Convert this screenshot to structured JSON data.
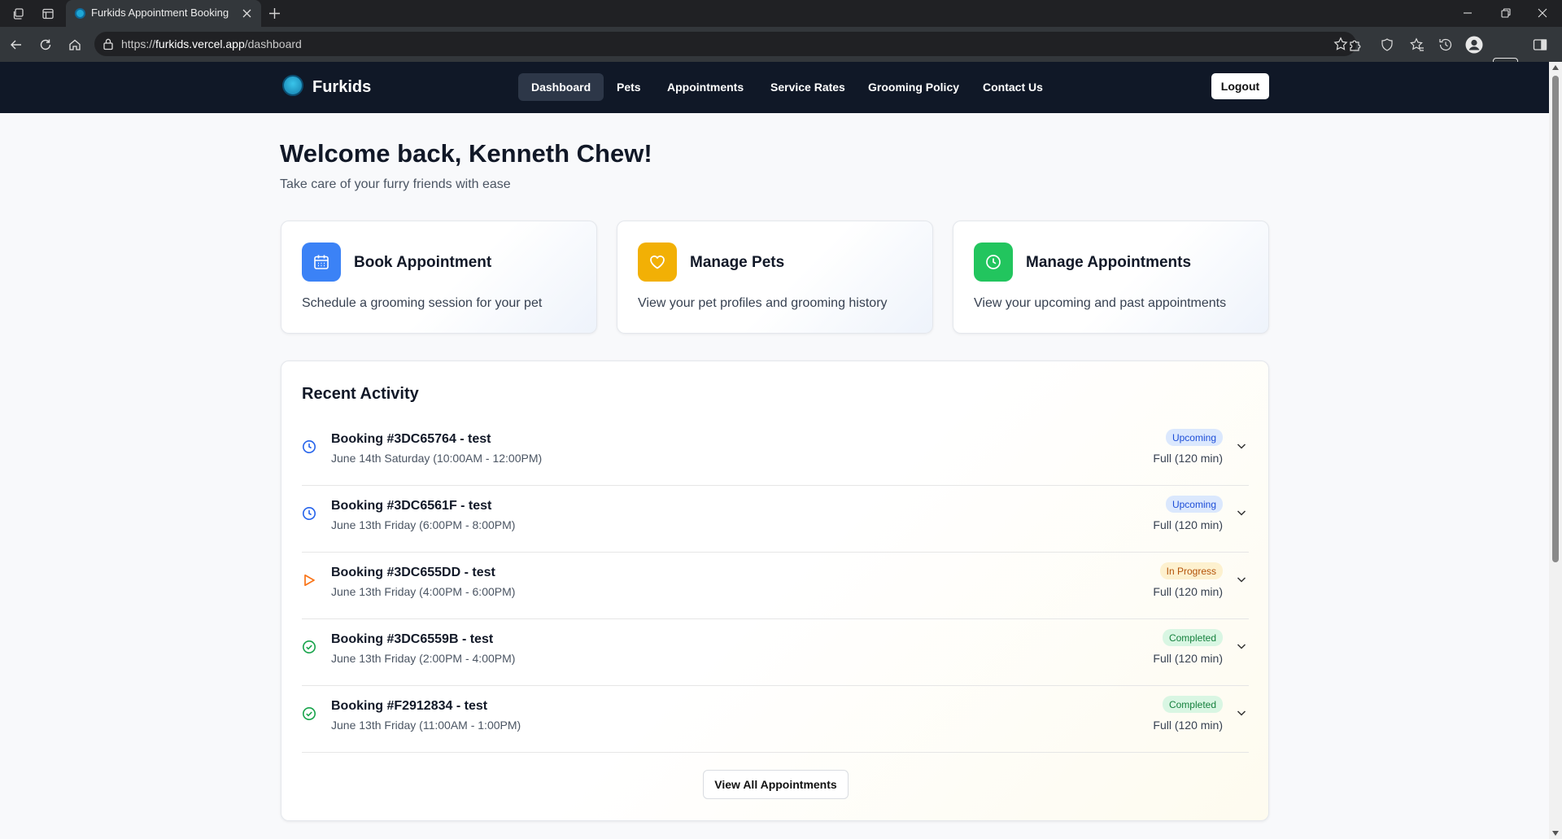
{
  "browser": {
    "tab_title": "Furkids Appointment Booking",
    "url_prefix": "https://",
    "url_host": "furkids.vercel.app",
    "url_path": "/dashboard"
  },
  "site": {
    "brand": "Furkids",
    "nav": [
      "Dashboard",
      "Pets",
      "Appointments",
      "Service Rates",
      "Grooming Policy",
      "Contact Us"
    ],
    "active_nav": "Dashboard",
    "logout_label": "Logout"
  },
  "welcome": {
    "title": "Welcome back, Kenneth Chew!",
    "subtitle": "Take care of your furry friends with ease"
  },
  "cards": [
    {
      "title": "Book Appointment",
      "desc": "Schedule a grooming session for your pet",
      "icon": "calendar-icon",
      "color": "#3b82f6"
    },
    {
      "title": "Manage Pets",
      "desc": "View your pet profiles and grooming history",
      "icon": "heart-icon",
      "color": "#f2b005"
    },
    {
      "title": "Manage Appointments",
      "desc": "View your upcoming and past appointments",
      "icon": "clock-icon",
      "color": "#22c55e"
    }
  ],
  "activity": {
    "title": "Recent Activity",
    "items": [
      {
        "title": "Booking #3DC65764 - test",
        "subtitle": "June 14th Saturday (10:00AM - 12:00PM)",
        "status": "Upcoming",
        "duration": "Full (120 min)",
        "status_icon": "clock-icon"
      },
      {
        "title": "Booking #3DC6561F - test",
        "subtitle": "June 13th Friday (6:00PM - 8:00PM)",
        "status": "Upcoming",
        "duration": "Full (120 min)",
        "status_icon": "clock-icon"
      },
      {
        "title": "Booking #3DC655DD - test",
        "subtitle": "June 13th Friday (4:00PM - 6:00PM)",
        "status": "In Progress",
        "duration": "Full (120 min)",
        "status_icon": "play-icon"
      },
      {
        "title": "Booking #3DC6559B - test",
        "subtitle": "June 13th Friday (2:00PM - 4:00PM)",
        "status": "Completed",
        "duration": "Full (120 min)",
        "status_icon": "check-circle-icon"
      },
      {
        "title": "Booking #F2912834 - test",
        "subtitle": "June 13th Friday (11:00AM - 1:00PM)",
        "status": "Completed",
        "duration": "Full (120 min)",
        "status_icon": "check-circle-icon"
      }
    ],
    "view_all_label": "View All Appointments"
  },
  "status_colors": {
    "Upcoming": "#2563eb",
    "In Progress": "#f97316",
    "Completed": "#16a34a"
  }
}
